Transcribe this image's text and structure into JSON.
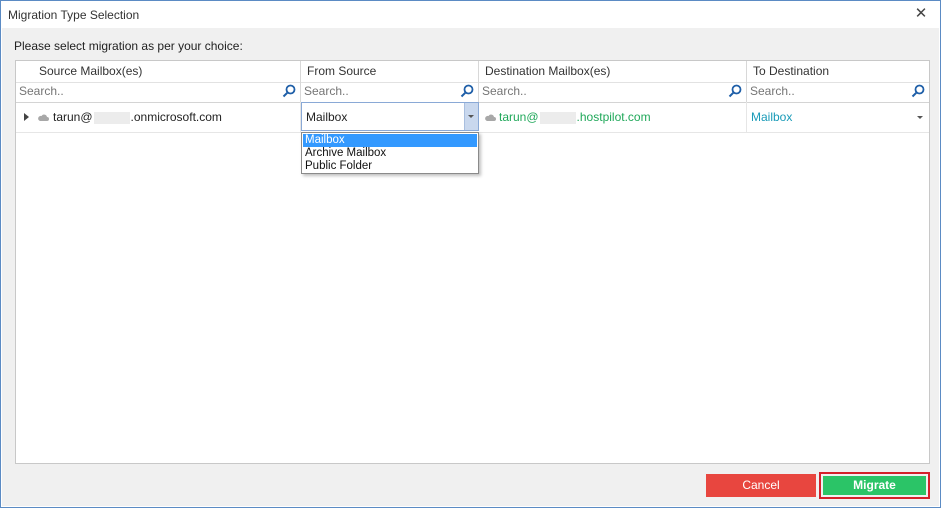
{
  "window": {
    "title": "Migration Type Selection"
  },
  "instruction": "Please select migration as per your choice:",
  "columns": [
    {
      "header": "Source Mailbox(es)",
      "search_placeholder": "Search.."
    },
    {
      "header": "From Source",
      "search_placeholder": "Search.."
    },
    {
      "header": "Destination Mailbox(es)",
      "search_placeholder": "Search.."
    },
    {
      "header": "To Destination",
      "search_placeholder": "Search.."
    }
  ],
  "row": {
    "source_prefix": "tarun@",
    "source_suffix": ".onmicrosoft.com",
    "from_source_value": "Mailbox",
    "destination_prefix": "tarun@",
    "destination_suffix": ".hostpilot.com",
    "to_destination_value": "Mailbox"
  },
  "dropdown_options": [
    "Mailbox",
    "Archive Mailbox",
    "Public Folder"
  ],
  "buttons": {
    "cancel": "Cancel",
    "migrate": "Migrate"
  },
  "colors": {
    "cancel": "#e8463f",
    "migrate": "#2bc467",
    "destination_text": "#20a85a",
    "to_destination_text": "#1a9bb8",
    "selection": "#3399ff"
  }
}
